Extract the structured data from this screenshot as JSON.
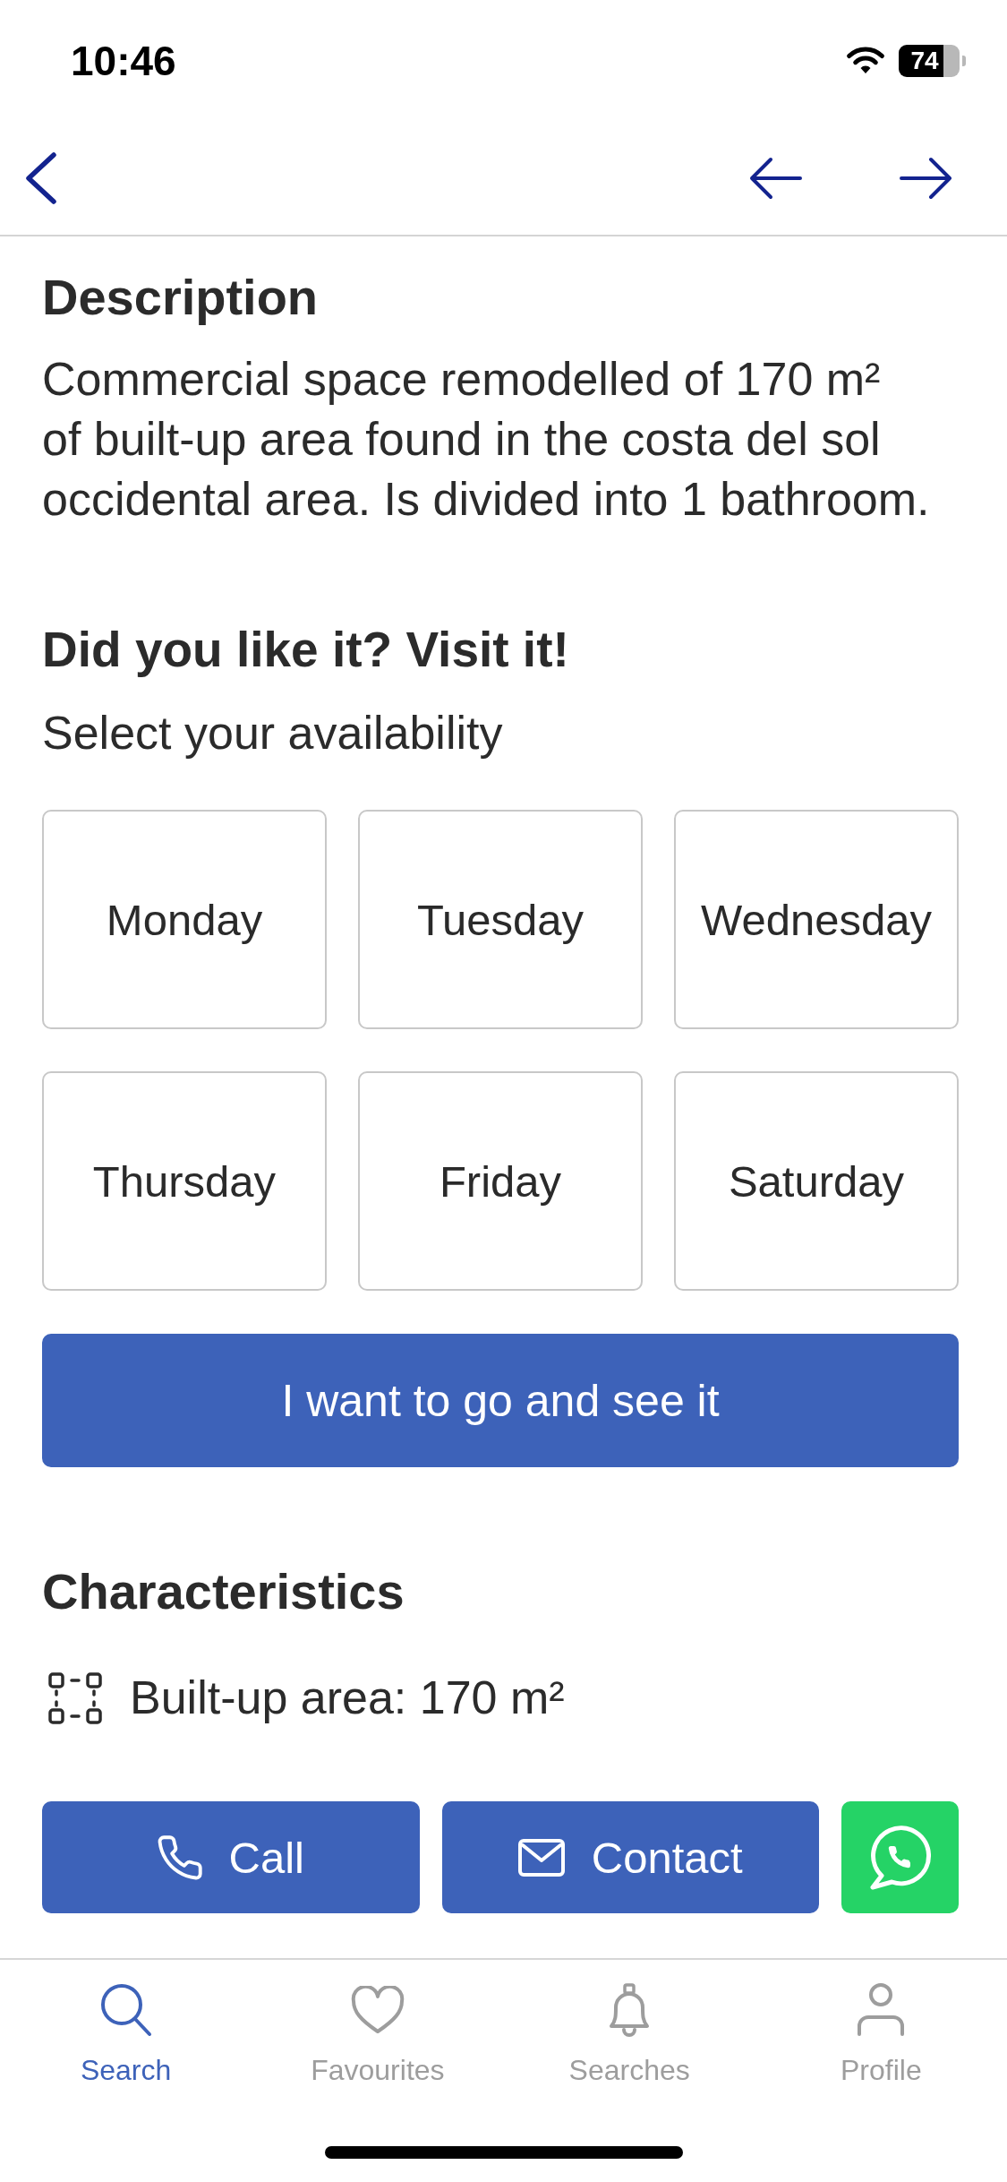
{
  "status_bar": {
    "time": "10:46",
    "battery": "74"
  },
  "description": {
    "title": "Description",
    "text_lines": [
      "Commercial space remodelled of 170 m²",
      "of built-up area found in the costa del sol",
      "occidental area. Is divided into 1 bathroom."
    ]
  },
  "visit": {
    "title": "Did you like it? Visit it!",
    "subtitle": "Select your availability",
    "days": [
      {
        "label": "Monday",
        "selected": false
      },
      {
        "label": "Tuesday",
        "selected": false
      },
      {
        "label": "Wednesday",
        "selected": false
      },
      {
        "label": "Thursday",
        "selected": false
      },
      {
        "label": "Friday",
        "selected": false
      },
      {
        "label": "Saturday",
        "selected": false
      }
    ],
    "submit_button": "I want to go and see it"
  },
  "characteristics": {
    "title": "Characteristics",
    "items": [
      {
        "kind": "area",
        "label": "Built-up area: 170 m²"
      }
    ]
  },
  "contact_actions": [
    {
      "kind": "call",
      "label": "Call"
    },
    {
      "kind": "email",
      "label": "Contact"
    },
    {
      "kind": "whatsapp"
    }
  ],
  "tab_bar": {
    "tabs": [
      {
        "kind": "search",
        "label": "Search",
        "selected": true
      },
      {
        "kind": "favourites",
        "label": "Favourites",
        "selected": false
      },
      {
        "kind": "searches",
        "label": "Searches",
        "selected": false
      },
      {
        "kind": "profile",
        "label": "Profile",
        "selected": false
      }
    ]
  }
}
